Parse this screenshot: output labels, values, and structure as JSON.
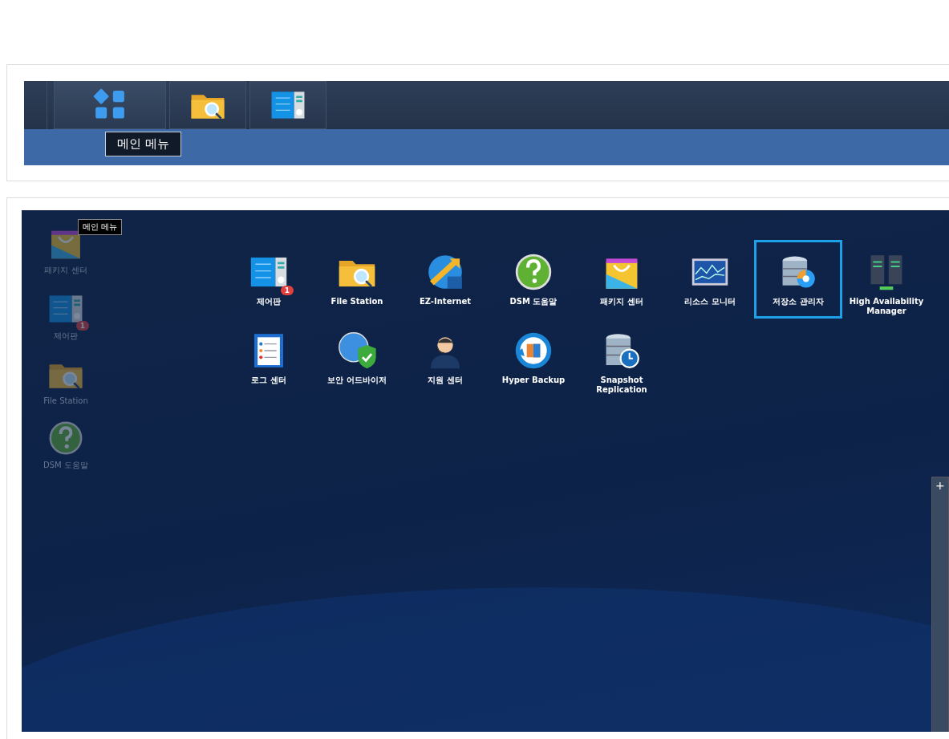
{
  "taskbar_panel": {
    "buttons": [
      {
        "kind": "main-menu",
        "hovered": true
      },
      {
        "kind": "folder",
        "hovered": false
      },
      {
        "kind": "control-panel",
        "hovered": false
      }
    ],
    "tooltip": "메인 메뉴"
  },
  "desktop_panel": {
    "tooltip": "메인 메뉴",
    "shortcuts": [
      {
        "label": "패키지 센터",
        "kind": "package"
      },
      {
        "label": "제어판",
        "kind": "control-panel",
        "badge": "1"
      },
      {
        "label": "File Station",
        "kind": "folder"
      },
      {
        "label": "DSM 도움말",
        "kind": "help"
      }
    ],
    "main_menu": [
      {
        "label": "제어판",
        "kind": "control-panel",
        "badge": "1",
        "selected": false
      },
      {
        "label": "File Station",
        "kind": "folder",
        "selected": false
      },
      {
        "label": "EZ-Internet",
        "kind": "globe-ez",
        "selected": false
      },
      {
        "label": "DSM 도움말",
        "kind": "help",
        "selected": false
      },
      {
        "label": "패키지 센터",
        "kind": "package",
        "selected": false
      },
      {
        "label": "리소스 모니터",
        "kind": "monitor",
        "selected": false
      },
      {
        "label": "저장소 관리자",
        "kind": "storage",
        "selected": true
      },
      {
        "label": "High Availability Manager",
        "kind": "servers",
        "selected": false
      },
      {
        "label": "로그 센터",
        "kind": "log",
        "selected": false
      },
      {
        "label": "보안 어드바이저",
        "kind": "shield-globe",
        "selected": false
      },
      {
        "label": "지원 센터",
        "kind": "person",
        "selected": false
      },
      {
        "label": "Hyper Backup",
        "kind": "backup",
        "selected": false
      },
      {
        "label": "Snapshot Replication",
        "kind": "snapshot",
        "selected": false
      }
    ],
    "widget_button": "+"
  }
}
